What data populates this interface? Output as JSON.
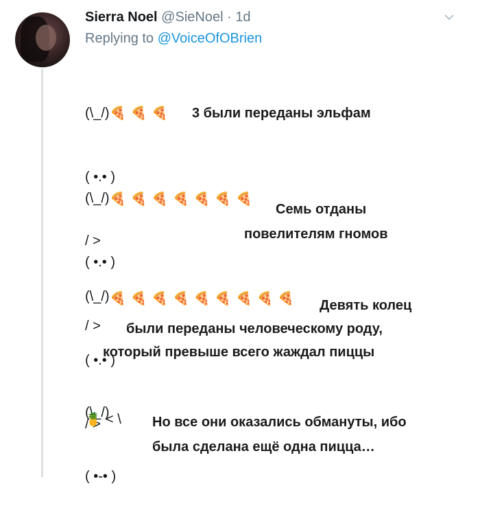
{
  "tweet": {
    "name": "Sierra Noel",
    "handle": "@SieNoel",
    "separator": "·",
    "time": "1d",
    "replying_prefix": "Replying to",
    "replying_to": "@VoiceOfOBrien"
  },
  "blocks": [
    {
      "ears": "(\\_/)",
      "face": "( •.• )",
      "arms": "/ >",
      "pizza_count": 3,
      "pizzas": "🍕🍕🍕",
      "caption_lines": [
        "3 были переданы эльфам"
      ]
    },
    {
      "ears": "(\\_/)",
      "face": "( •.• )",
      "arms": "/ >",
      "pizza_count": 7,
      "pizzas": "🍕🍕🍕🍕🍕🍕🍕",
      "caption_lines": [
        "Семь отданы",
        "повелителям гномов"
      ]
    },
    {
      "ears": "(\\_/)",
      "face": "( •.• )",
      "arms": "/ >",
      "pizza_count": 9,
      "pizzas": "🍕🍕🍕🍕🍕🍕🍕🍕🍕",
      "caption_lines": [
        "Девять колец",
        "были переданы человеческому роду,",
        "который превыше всего жаждал пиццы"
      ]
    },
    {
      "ears": "(\\_/)",
      "face": "( •-• )",
      "arms": "< \\",
      "held_item": "🍍",
      "caption_lines": [
        "Но все они оказались обмануты, ибо",
        "была сделана ещё одна пицца…"
      ]
    }
  ]
}
